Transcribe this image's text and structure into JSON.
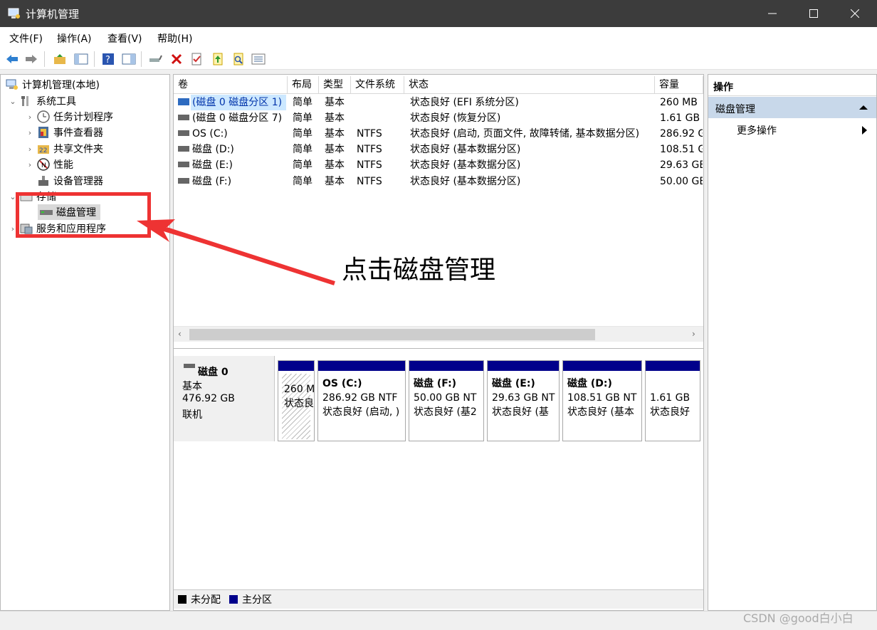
{
  "window": {
    "title": "计算机管理",
    "controls": [
      "minimize",
      "maximize",
      "close"
    ]
  },
  "menu": [
    "文件(F)",
    "操作(A)",
    "查看(V)",
    "帮助(H)"
  ],
  "toolbar_icons": [
    "back-icon",
    "forward-icon",
    "up-folder-icon",
    "show-hide-tree-icon",
    "help-icon",
    "console-pane-icon",
    "connect-icon",
    "delete-icon",
    "properties-icon",
    "export-icon",
    "search-icon",
    "details-icon"
  ],
  "tree": {
    "root": "计算机管理(本地)",
    "system_tools": "系统工具",
    "task_scheduler": "任务计划程序",
    "event_viewer": "事件查看器",
    "shared_folders": "共享文件夹",
    "performance": "性能",
    "device_manager": "设备管理器",
    "storage": "存储",
    "disk_management": "磁盘管理",
    "services_apps": "服务和应用程序"
  },
  "table": {
    "headers": {
      "volume": "卷",
      "layout": "布局",
      "type": "类型",
      "fs": "文件系统",
      "status": "状态",
      "capacity": "容量"
    },
    "rows": [
      {
        "volume": "(磁盘 0 磁盘分区 1)",
        "layout": "简单",
        "type": "基本",
        "fs": "",
        "status": "状态良好 (EFI 系统分区)",
        "capacity": "260 MB"
      },
      {
        "volume": "(磁盘 0 磁盘分区 7)",
        "layout": "简单",
        "type": "基本",
        "fs": "",
        "status": "状态良好 (恢复分区)",
        "capacity": "1.61 GB"
      },
      {
        "volume": "OS (C:)",
        "layout": "简单",
        "type": "基本",
        "fs": "NTFS",
        "status": "状态良好 (启动, 页面文件, 故障转储, 基本数据分区)",
        "capacity": "286.92 G"
      },
      {
        "volume": "磁盘 (D:)",
        "layout": "简单",
        "type": "基本",
        "fs": "NTFS",
        "status": "状态良好 (基本数据分区)",
        "capacity": "108.51 G"
      },
      {
        "volume": "磁盘 (E:)",
        "layout": "简单",
        "type": "基本",
        "fs": "NTFS",
        "status": "状态良好 (基本数据分区)",
        "capacity": "29.63 GB"
      },
      {
        "volume": "磁盘 (F:)",
        "layout": "简单",
        "type": "基本",
        "fs": "NTFS",
        "status": "状态良好 (基本数据分区)",
        "capacity": "50.00 GB"
      }
    ]
  },
  "disk": {
    "name": "磁盘 0",
    "kind": "基本",
    "size": "476.92 GB",
    "state": "联机",
    "partitions": [
      {
        "title": "",
        "size": "260 M",
        "status": "状态良"
      },
      {
        "title": "OS  (C:)",
        "size": "286.92 GB NTF",
        "status": "状态良好 (启动, )"
      },
      {
        "title": "磁盘  (F:)",
        "size": "50.00 GB NT",
        "status": "状态良好 (基2"
      },
      {
        "title": "磁盘  (E:)",
        "size": "29.63 GB NT",
        "status": "状态良好 (基"
      },
      {
        "title": "磁盘  (D:)",
        "size": "108.51 GB NT",
        "status": "状态良好 (基本"
      },
      {
        "title": "",
        "size": "1.61 GB",
        "status": "状态良好"
      }
    ]
  },
  "legend": {
    "unallocated": "未分配",
    "primary": "主分区"
  },
  "actions": {
    "header": "操作",
    "section": "磁盘管理",
    "more": "更多操作"
  },
  "annotation": {
    "callout": "点击磁盘管理"
  },
  "watermark": "CSDN @good白小白",
  "colors": {
    "primary_partition": "#00008b",
    "annotation_red": "#ee3333",
    "selection": "#cce8ff"
  }
}
